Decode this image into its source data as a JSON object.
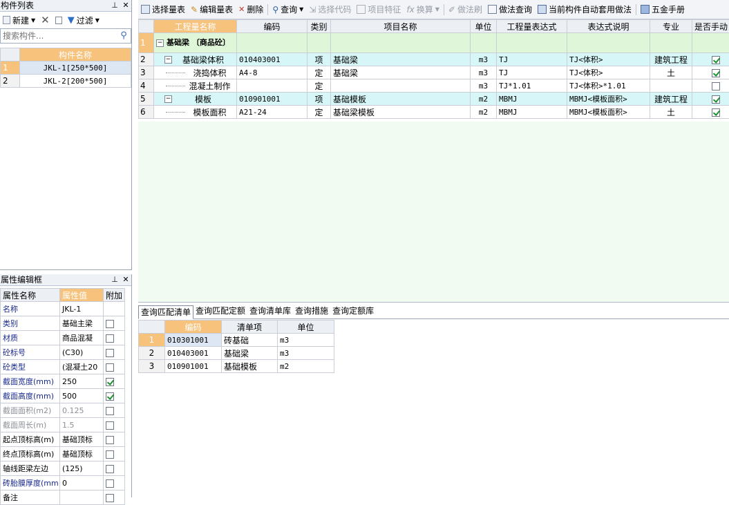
{
  "left_top": {
    "title": "构件列表",
    "toolbar": {
      "new_label": "新建",
      "filter_label": "过滤"
    },
    "search_placeholder": "搜索构件...",
    "column_header": "构件名称",
    "items": [
      {
        "num": "1",
        "name": "JKL-1[250*500]"
      },
      {
        "num": "2",
        "name": "JKL-2[200*500]"
      }
    ]
  },
  "left_bottom": {
    "title": "属性编辑框",
    "headers": {
      "name": "属性名称",
      "value": "属性值",
      "extra": "附加"
    },
    "rows": [
      {
        "name": "名称",
        "value": "JKL-1",
        "check": null,
        "style": "blue"
      },
      {
        "name": "类别",
        "value": "基础主梁",
        "check": false,
        "style": "blue"
      },
      {
        "name": "材质",
        "value": "商品混凝",
        "check": false,
        "style": "blue"
      },
      {
        "name": "砼标号",
        "value": "(C30)",
        "check": false,
        "style": "blue"
      },
      {
        "name": "砼类型",
        "value": "(混凝土20",
        "check": false,
        "style": "blue"
      },
      {
        "name": "截面宽度(mm)",
        "value": "250",
        "check": true,
        "style": "blue"
      },
      {
        "name": "截面高度(mm)",
        "value": "500",
        "check": true,
        "style": "blue"
      },
      {
        "name": "截面面积(m2)",
        "value": "0.125",
        "check": false,
        "style": "gray"
      },
      {
        "name": "截面周长(m)",
        "value": "1.5",
        "check": false,
        "style": "gray"
      },
      {
        "name": "起点顶标高(m)",
        "value": "基础顶标",
        "check": false,
        "style": "black"
      },
      {
        "name": "终点顶标高(m)",
        "value": "基础顶标",
        "check": false,
        "style": "black"
      },
      {
        "name": "轴线距梁左边",
        "value": "(125)",
        "check": false,
        "style": "black"
      },
      {
        "name": "砖胎膜厚度(mm",
        "value": "0",
        "check": false,
        "style": "blue"
      },
      {
        "name": "备注",
        "value": "",
        "check": false,
        "style": "black"
      }
    ]
  },
  "toolbar": {
    "select_quantity": "选择量表",
    "edit_quantity": "编辑量表",
    "delete": "删除",
    "query": "查询",
    "select_code": "选择代码",
    "item_feature": "项目特征",
    "convert": "换算",
    "method_brush": "做法刷",
    "method_query": "做法查询",
    "auto_apply": "当前构件自动套用做法",
    "manual": "五金手册"
  },
  "main_table": {
    "headers": [
      "工程量名称",
      "编码",
      "类别",
      "项目名称",
      "单位",
      "工程量表达式",
      "表达式说明",
      "专业",
      "是否手动"
    ],
    "rows": [
      {
        "num": "1",
        "name": "基础梁 〔商品砼〕",
        "code": "",
        "type": "",
        "item": "",
        "unit": "",
        "expr": "",
        "desc": "",
        "major": "",
        "check": null,
        "level": 0
      },
      {
        "num": "2",
        "name": "基础梁体积",
        "code": "010403001",
        "type": "项",
        "item": "基础梁",
        "unit": "m3",
        "expr": "TJ",
        "desc": "TJ<体积>",
        "major": "建筑工程",
        "check": true,
        "level": 1
      },
      {
        "num": "3",
        "name": "浇捣体积",
        "code": "A4-8",
        "type": "定",
        "item": "基础梁",
        "unit": "m3",
        "expr": "TJ",
        "desc": "TJ<体积>",
        "major": "土",
        "check": true,
        "level": 2
      },
      {
        "num": "4",
        "name": "混凝土制作",
        "code": "",
        "type": "定",
        "item": "",
        "unit": "m3",
        "expr": "TJ*1.01",
        "desc": "TJ<体积>*1.01",
        "major": "",
        "check": false,
        "level": 2
      },
      {
        "num": "5",
        "name": "模板",
        "code": "010901001",
        "type": "项",
        "item": "基础模板",
        "unit": "m2",
        "expr": "MBMJ",
        "desc": "MBMJ<模板面积>",
        "major": "建筑工程",
        "check": true,
        "level": 1
      },
      {
        "num": "6",
        "name": "模板面积",
        "code": "A21-24",
        "type": "定",
        "item": "基础梁模板",
        "unit": "m2",
        "expr": "MBMJ",
        "desc": "MBMJ<模板面积>",
        "major": "土",
        "check": true,
        "level": 2
      }
    ]
  },
  "bottom_tabs": [
    "查询匹配清单",
    "查询匹配定额",
    "查询清单库",
    "查询措施",
    "查询定额库"
  ],
  "bottom_table": {
    "headers": [
      "编码",
      "清单项",
      "单位"
    ],
    "rows": [
      {
        "num": "1",
        "code": "010301001",
        "name": "砖基础",
        "unit": "m3"
      },
      {
        "num": "2",
        "code": "010403001",
        "name": "基础梁",
        "unit": "m3"
      },
      {
        "num": "3",
        "code": "010901001",
        "name": "基础模板",
        "unit": "m2"
      }
    ]
  }
}
